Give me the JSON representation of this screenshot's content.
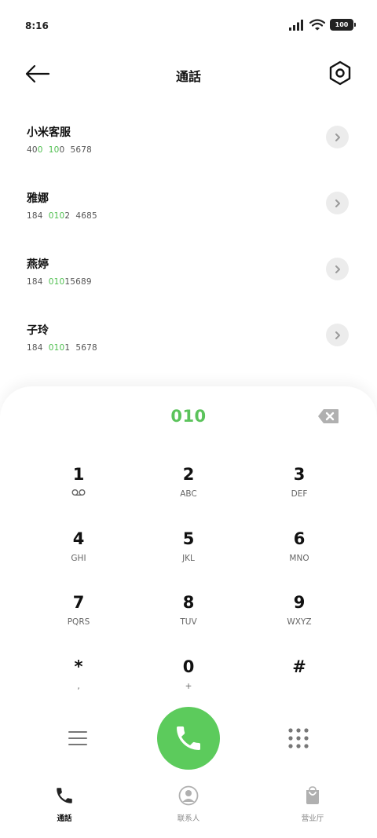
{
  "status": {
    "time": "8:16",
    "battery": "100"
  },
  "header": {
    "title": "通話"
  },
  "contacts": [
    {
      "name": "小米客服",
      "number_parts": [
        {
          "t": "40",
          "hl": false
        },
        {
          "t": "0",
          "hl": true
        },
        {
          "t": "  ",
          "hl": false
        },
        {
          "t": "10",
          "hl": true
        },
        {
          "t": "0",
          "hl": false
        },
        {
          "t": "  5678",
          "hl": false
        }
      ]
    },
    {
      "name": "雅娜",
      "number_parts": [
        {
          "t": "184  ",
          "hl": false
        },
        {
          "t": "010",
          "hl": true
        },
        {
          "t": "2  4685",
          "hl": false
        }
      ]
    },
    {
      "name": "燕婷",
      "number_parts": [
        {
          "t": "184  ",
          "hl": false
        },
        {
          "t": "010",
          "hl": true
        },
        {
          "t": "15689",
          "hl": false
        }
      ]
    },
    {
      "name": "子玲",
      "number_parts": [
        {
          "t": "184  ",
          "hl": false
        },
        {
          "t": "010",
          "hl": true
        },
        {
          "t": "1  5678",
          "hl": false
        }
      ]
    }
  ],
  "dialer": {
    "dialed": "010",
    "keys": [
      {
        "digit": "1",
        "letters": "",
        "icon": "voicemail-icon"
      },
      {
        "digit": "2",
        "letters": "ABC"
      },
      {
        "digit": "3",
        "letters": "DEF"
      },
      {
        "digit": "4",
        "letters": "GHI"
      },
      {
        "digit": "5",
        "letters": "JKL"
      },
      {
        "digit": "6",
        "letters": "MNO"
      },
      {
        "digit": "7",
        "letters": "PQRS"
      },
      {
        "digit": "8",
        "letters": "TUV"
      },
      {
        "digit": "9",
        "letters": "WXYZ"
      },
      {
        "digit": "*",
        "letters": ","
      },
      {
        "digit": "0",
        "letters": "+"
      },
      {
        "digit": "#",
        "letters": ""
      }
    ]
  },
  "nav": [
    {
      "label": "通話",
      "icon": "phone-icon",
      "active": true
    },
    {
      "label": "联系人",
      "icon": "contact-icon",
      "active": false
    },
    {
      "label": "营业厅",
      "icon": "shopping-bag-icon",
      "active": false
    }
  ],
  "colors": {
    "accent": "#5ccb5c",
    "highlight": "#4fbf4f"
  }
}
